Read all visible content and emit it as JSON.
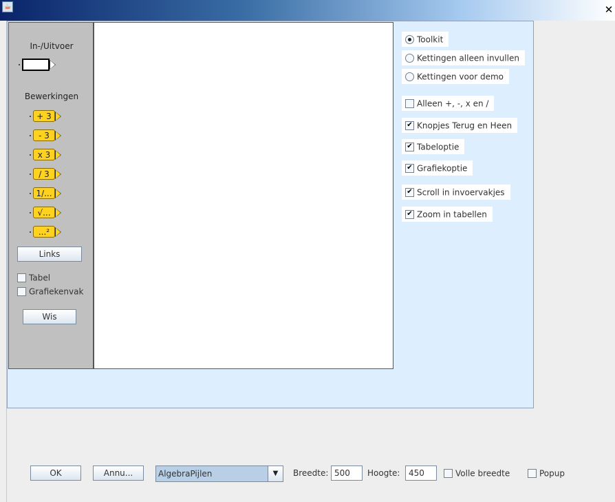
{
  "window": {
    "close_glyph": "✕",
    "app_icon": "java-cup-icon"
  },
  "toolbox": {
    "io_title": "In-/Uitvoer",
    "ops_title": "Bewerkingen",
    "ops": [
      "+ 3",
      "- 3",
      "x 3",
      "/ 3",
      "1/...",
      "√...",
      "...²"
    ],
    "links_label": "Links",
    "tabel_label": "Tabel",
    "grafiekenvak_label": "Grafiekenvak",
    "wis_label": "Wis"
  },
  "options": {
    "radios": [
      {
        "label": "Toolkit",
        "selected": true
      },
      {
        "label": "Kettingen alleen invullen",
        "selected": false
      },
      {
        "label": "Kettingen voor demo",
        "selected": false
      }
    ],
    "checks": [
      {
        "label": "Alleen +, -, x en /",
        "checked": false
      },
      {
        "label": "Knopjes Terug en Heen",
        "checked": true
      },
      {
        "label": "Tabeloptie",
        "checked": true
      },
      {
        "label": "Grafiekoptie",
        "checked": true
      },
      {
        "label": "Scroll in invoervakjes",
        "checked": true
      },
      {
        "label": "Zoom in tabellen",
        "checked": true
      }
    ]
  },
  "bottom": {
    "ok_label": "OK",
    "cancel_label": "Annu...",
    "type_value": "AlgebraPijlen",
    "breedte_label": "Breedte:",
    "breedte_value": "500",
    "hoogte_label": "Hoogte:",
    "hoogte_value": "450",
    "volle_breedte_label": "Volle breedte",
    "volle_breedte_checked": false,
    "popup_label": "Popup",
    "popup_checked": false
  }
}
